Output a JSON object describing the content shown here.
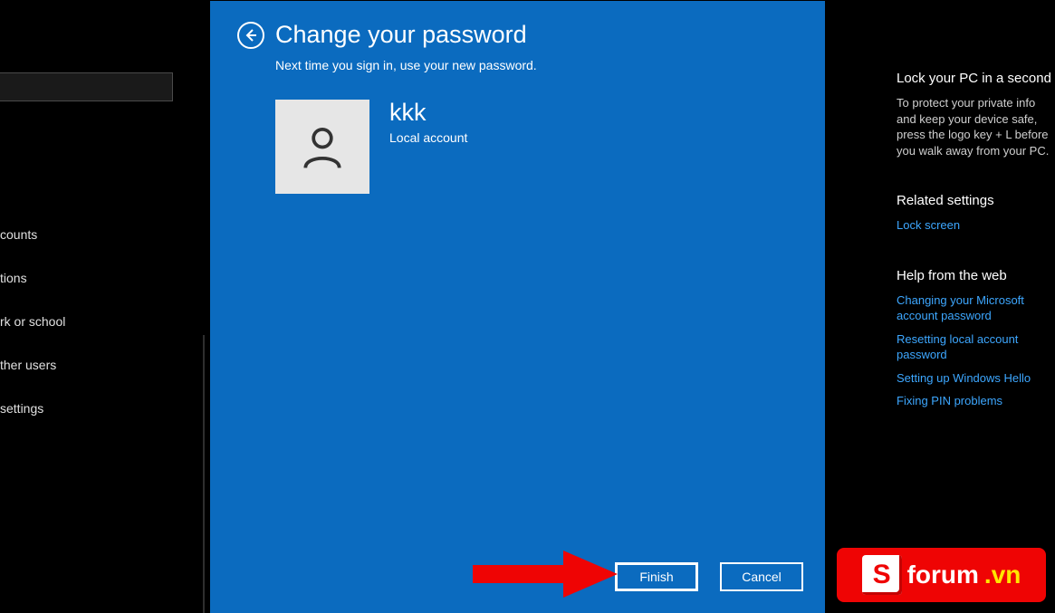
{
  "sidebar": {
    "search_placeholder": "",
    "items": [
      {
        "label": "counts"
      },
      {
        "label": "tions"
      },
      {
        "label": "rk or school"
      },
      {
        "label": "ther users"
      },
      {
        "label": "settings"
      }
    ]
  },
  "dialog": {
    "title": "Change your password",
    "subtitle": "Next time you sign in, use your new password.",
    "account_name": "kkk",
    "account_type": "Local account",
    "finish_label": "Finish",
    "cancel_label": "Cancel"
  },
  "right": {
    "lock_heading": "Lock your PC in a second",
    "lock_body": "To protect your private info and keep your device safe, press the logo key + L before you walk away from your PC.",
    "related_heading": "Related settings",
    "lock_screen_link": "Lock screen",
    "help_heading": "Help from the web",
    "help_links": [
      "Changing your Microsoft account password",
      "Resetting local account password",
      "Setting up Windows Hello",
      "Fixing PIN problems"
    ]
  },
  "watermark": {
    "letter": "S",
    "text": "forum",
    "tld": ".vn"
  }
}
